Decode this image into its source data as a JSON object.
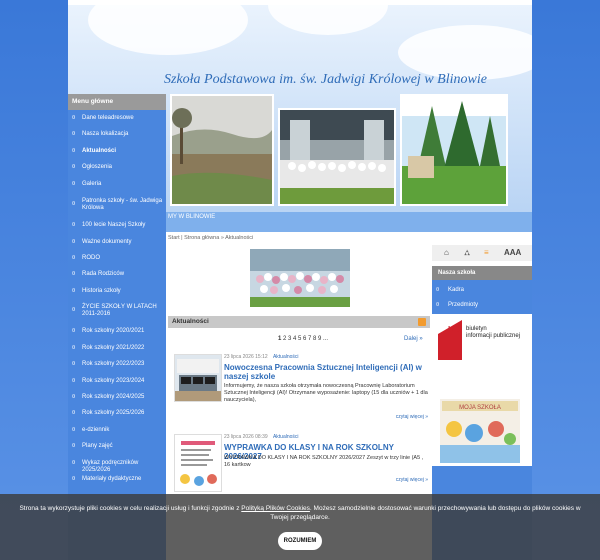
{
  "site": {
    "title": "Szkoła Podstawowa im. św. Jadwigi Królowej w Blinowie",
    "strip_label": "MY W BLINOWIE"
  },
  "left_menu": {
    "header": "Menu główne",
    "items": [
      {
        "label": "Dane teleadresowe"
      },
      {
        "label": "Nasza lokalizacja"
      },
      {
        "label": "Aktualności"
      },
      {
        "label": "Ogłoszenia"
      },
      {
        "label": "Galeria"
      },
      {
        "label": "Patronka szkoły - św. Jadwiga Królowa"
      },
      {
        "label": "100 lecie Naszej Szkoły"
      },
      {
        "label": "Ważne dokumenty"
      },
      {
        "label": "RODO"
      },
      {
        "label": "Rada Rodziców"
      },
      {
        "label": "Historia szkoły"
      },
      {
        "label": "ŻYCIE SZKOŁY W LATACH 2011-2016"
      },
      {
        "label": "Rok szkolny 2020/2021"
      },
      {
        "label": "Rok szkolny 2021/2022"
      },
      {
        "label": "Rok szkolny 2022/2023"
      },
      {
        "label": "Rok szkolny 2023/2024"
      },
      {
        "label": "Rok szkolny 2024/2025"
      },
      {
        "label": "Rok szkolny 2025/2026"
      },
      {
        "label": "e-dziennik"
      },
      {
        "label": "Plany zajęć"
      },
      {
        "label": "Wykaz podręczników 2025/2026"
      },
      {
        "label": "Materiały dydaktyczne"
      }
    ]
  },
  "breadcrumb": {
    "label": "Start",
    "items": [
      "Strona główna",
      "Aktualności"
    ]
  },
  "news": {
    "section_title": "Aktualności",
    "pager_first": "1",
    "pager_rest": "2 3 4 5 6 7 8 9 ...",
    "next_label": "Dalej »",
    "articles": [
      {
        "meta": "23 lipca 2026 15:12",
        "category": "Aktualności",
        "title": "Nowoczesna Pracownia Sztucznej Inteligencji (AI) w naszej szkole",
        "text": "Informujemy, że nasza szkoła otrzymała nowoczesną Pracownię Laboratorium Sztucznej Inteligencji (AI)! Otrzymane wyposażenie: laptopy (15 dla uczniów + 1 dla nauczyciela),",
        "more": "czytaj więcej »"
      },
      {
        "meta": "23 lipca 2026 08:39",
        "category": "Aktualności",
        "title": "WYPRAWKA DO KLASY I NA ROK SZKOLNY 2026/2027",
        "text": "WYPRAWKA DO KLASY I NA ROK SZKOLNY 2026/2027 Zeszyt w trzy linie (A5 , 16 kartkow",
        "more": "czytaj więcej »"
      }
    ]
  },
  "right": {
    "tools": [
      "⌂",
      "⛼",
      "≡",
      "AAA"
    ],
    "box_title": "Nasza szkoła",
    "links": [
      "Kadra",
      "Przedmioty"
    ],
    "bip_line1": "biuletyn",
    "bip_line2": "informacji publicznej",
    "bip_logo": "bip"
  },
  "cookie": {
    "text_before": "Strona ta wykorzystuje pliki cookies w celu realizacji usług i funkcji zgodnie z ",
    "link": "Polityką Plików Cookies",
    "text_after": ". Możesz samodzielnie dostosować warunki przechowywania lub dostępu do plików cookies w Twojej przeglądarce.",
    "button": "ROZUMIEM"
  },
  "colors": {
    "brand_blue": "#4a86de",
    "title_blue": "#2f6cb8"
  }
}
